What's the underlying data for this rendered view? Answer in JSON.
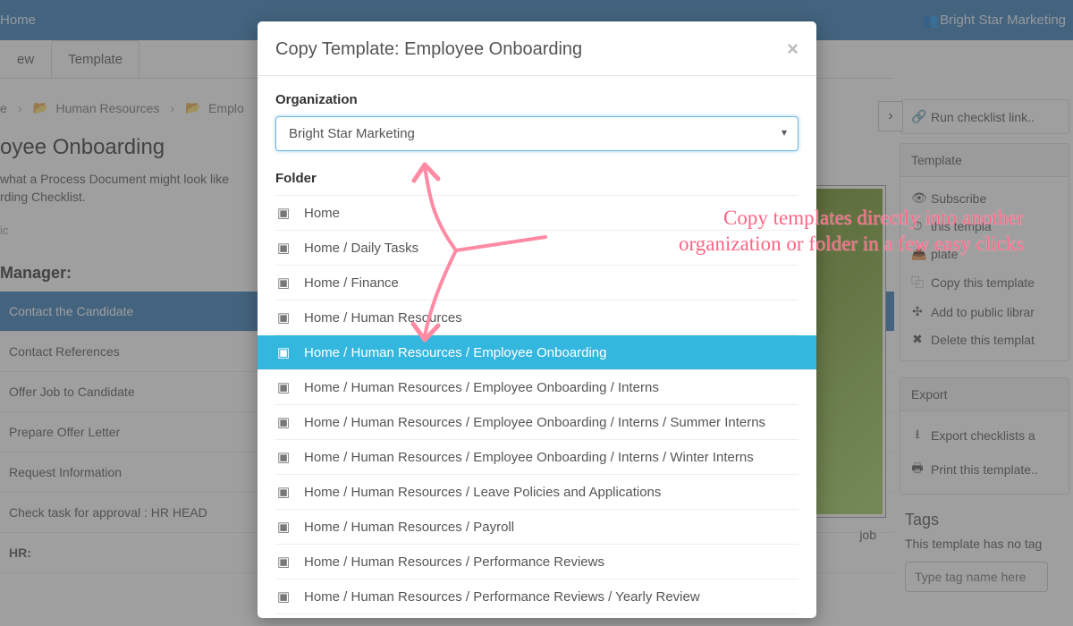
{
  "topbar": {
    "home": "Home",
    "org": "Bright Star Marketing"
  },
  "tabs": {
    "view": "ew",
    "template": "Template"
  },
  "breadcrumb": {
    "item0": "e",
    "item1": "Human Resources",
    "item2": "Emplo"
  },
  "page": {
    "title": "oyee Onboarding",
    "desc1": " what a Process Document might look like",
    "desc2": "rding Checklist.",
    "public": "ic"
  },
  "manager_label": "Manager:",
  "tasks": {
    "t0": "Contact the Candidate",
    "t1": "Contact References",
    "t2": "Offer Job to Candidate",
    "t3": "Prepare Offer Letter",
    "t4": "Request Information",
    "t5": "Check task for approval : HR HEAD",
    "hr": "HR:"
  },
  "right": {
    "run": "Run checklist link..",
    "template_head": "Template",
    "subscribe": "Subscribe",
    "schedule": "this templa",
    "archive": "plate",
    "copy": "Copy this template",
    "public": "Add to public librar",
    "delete": "Delete this templat",
    "export_head": "Export",
    "export_csv": "Export checklists a",
    "print": "Print this template..",
    "tags_head": "Tags",
    "tags_text": "This template has no tag",
    "tags_placeholder": "Type tag name here"
  },
  "img_caption": "job",
  "modal": {
    "title": "Copy Template: Employee Onboarding",
    "org_label": "Organization",
    "org_selected": "Bright Star Marketing",
    "folder_label": "Folder",
    "folders": {
      "f0": "Home",
      "f1": "Home / Daily Tasks",
      "f2": "Home / Finance",
      "f3": "Home / Human Resources",
      "f4": "Home / Human Resources / Employee Onboarding",
      "f5": "Home / Human Resources / Employee Onboarding / Interns",
      "f6": "Home / Human Resources / Employee Onboarding / Interns / Summer Interns",
      "f7": "Home / Human Resources / Employee Onboarding / Interns / Winter Interns",
      "f8": "Home / Human Resources / Leave Policies and Applications",
      "f9": "Home / Human Resources / Payroll",
      "f10": "Home / Human Resources / Performance Reviews",
      "f11": "Home / Human Resources / Performance Reviews / Yearly Review"
    }
  },
  "annotation": {
    "line1": "Copy templates directly into another",
    "line2": "organization or folder in a few easy clicks"
  }
}
